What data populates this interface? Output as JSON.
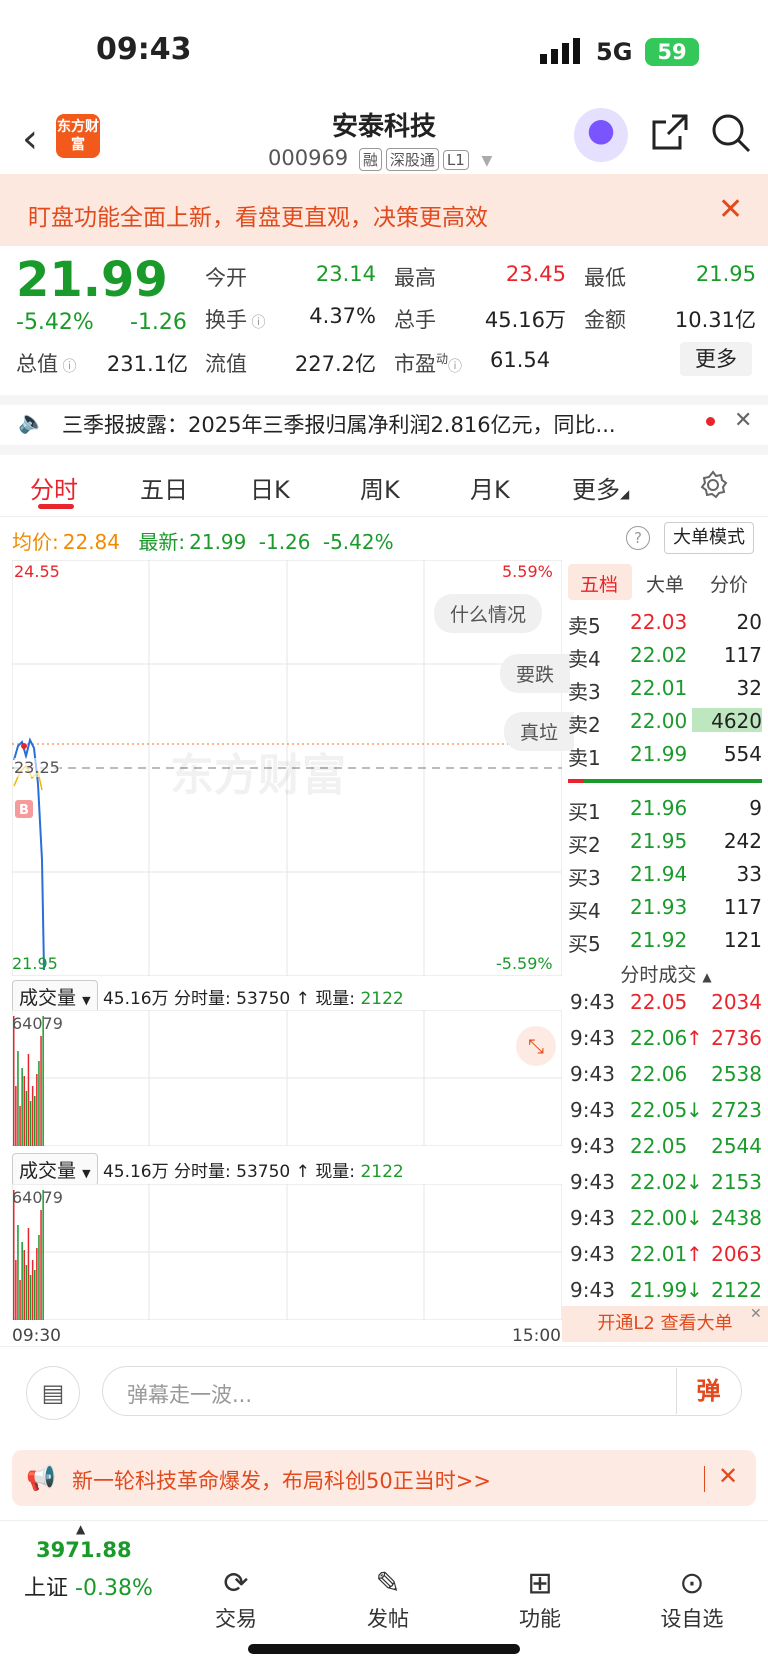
{
  "status": {
    "time": "09:43",
    "network": "5G",
    "battery": "59"
  },
  "header": {
    "title": "安泰科技",
    "code": "000969",
    "tags": [
      "融",
      "深股通",
      "L1"
    ],
    "logo": "东方财富"
  },
  "banner": {
    "text": "盯盘功能全面上新，看盘更直观，决策更高效"
  },
  "quote": {
    "price": "21.99",
    "pct": "-5.42%",
    "change": "-1.26",
    "open_label": "今开",
    "open": "23.14",
    "high_label": "最高",
    "high": "23.45",
    "low_label": "最低",
    "low": "21.95",
    "turnover_label": "换手",
    "turnover": "4.37%",
    "volume_label": "总手",
    "volume": "45.16万",
    "amount_label": "金额",
    "amount": "10.31亿",
    "mcap_label": "总值",
    "mcap": "231.1亿",
    "float_label": "流值",
    "float": "227.2亿",
    "pe_label": "市盈",
    "pe_sup": "动",
    "pe": "61.54",
    "more": "更多"
  },
  "news": {
    "text": "三季报披露：2025年三季报归属净利润2.816亿元，同比..."
  },
  "tabs": [
    "分时",
    "五日",
    "日K",
    "周K",
    "月K",
    "更多"
  ],
  "info": {
    "avg_label": "均价:",
    "avg": "22.84",
    "latest_label": "最新:",
    "latest": "21.99",
    "chg": "-1.26",
    "pct": "-5.42%",
    "big_mode": "大单模式"
  },
  "chart": {
    "y_top": "24.55",
    "y_mid": "23.25",
    "y_bot": "21.95",
    "pct_top": "5.59%",
    "pct_bot": "-5.59%",
    "time_start": "09:30",
    "time_end": "15:00",
    "watermark": "东方财富",
    "marker": "B",
    "prompts": [
      "什么情况",
      "要跌",
      "真垃"
    ]
  },
  "book_tabs": [
    "五档",
    "大单",
    "分价"
  ],
  "asks": [
    {
      "l": "卖5",
      "p": "22.03",
      "v": "20"
    },
    {
      "l": "卖4",
      "p": "22.02",
      "v": "117"
    },
    {
      "l": "卖3",
      "p": "22.01",
      "v": "32"
    },
    {
      "l": "卖2",
      "p": "22.00",
      "v": "4620"
    },
    {
      "l": "卖1",
      "p": "21.99",
      "v": "554"
    }
  ],
  "bids": [
    {
      "l": "买1",
      "p": "21.96",
      "v": "9"
    },
    {
      "l": "买2",
      "p": "21.95",
      "v": "242"
    },
    {
      "l": "买3",
      "p": "21.94",
      "v": "33"
    },
    {
      "l": "买4",
      "p": "21.93",
      "v": "117"
    },
    {
      "l": "买5",
      "p": "21.92",
      "v": "121"
    }
  ],
  "ticks_title": "分时成交",
  "ticks": [
    {
      "t": "9:43",
      "p": "22.05",
      "a": "",
      "v": "2034",
      "c": "red"
    },
    {
      "t": "9:43",
      "p": "22.06",
      "a": "↑",
      "v": "2736",
      "c": "red"
    },
    {
      "t": "9:43",
      "p": "22.06",
      "a": "",
      "v": "2538",
      "c": "green"
    },
    {
      "t": "9:43",
      "p": "22.05",
      "a": "↓",
      "v": "2723",
      "c": "green"
    },
    {
      "t": "9:43",
      "p": "22.05",
      "a": "",
      "v": "2544",
      "c": "green"
    },
    {
      "t": "9:43",
      "p": "22.02",
      "a": "↓",
      "v": "2153",
      "c": "green"
    },
    {
      "t": "9:43",
      "p": "22.00",
      "a": "↓",
      "v": "2438",
      "c": "green"
    },
    {
      "t": "9:43",
      "p": "22.01",
      "a": "↑",
      "v": "2063",
      "c": "red"
    },
    {
      "t": "9:43",
      "p": "21.99",
      "a": "↓",
      "v": "2122",
      "c": "green"
    }
  ],
  "l2_link": "开通L2 查看大单",
  "vol": {
    "label": "成交量",
    "total": "45.16万",
    "min_label": "分时量:",
    "min_val": "53750",
    "arrow": "↑",
    "now_label": "现量:",
    "now": "2122",
    "max": "64079"
  },
  "chat": {
    "placeholder": "弹幕走一波...",
    "send": "弹"
  },
  "promo": {
    "text": "新一轮科技革命爆发，布局科创50正当时>>"
  },
  "nav": {
    "index_value": "3971.88",
    "index_label": "上证",
    "index_pct": "-0.38%",
    "items": [
      "交易",
      "发帖",
      "功能",
      "设自选"
    ]
  }
}
